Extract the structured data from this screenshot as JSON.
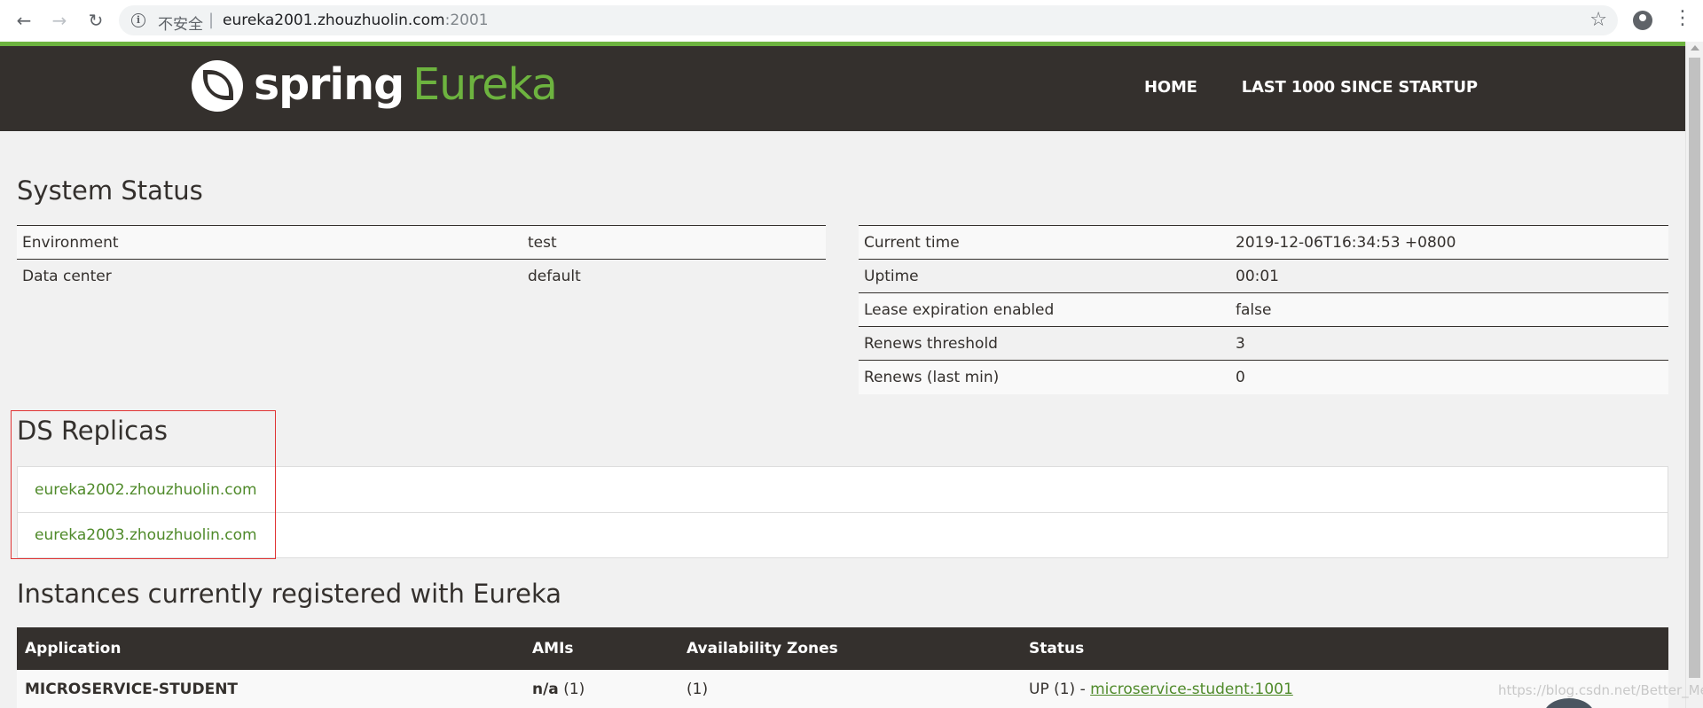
{
  "browser": {
    "back_icon": "arrow-left-icon",
    "forward_icon": "arrow-right-icon",
    "reload_icon": "reload-icon",
    "security_label": "不安全",
    "url_host": "eureka2001.zhouzhuolin.com",
    "url_port": ":2001",
    "bookmark_icon": "star-icon",
    "account_icon": "account-circle-icon",
    "menu_icon": "more-vert-icon"
  },
  "header": {
    "logo_spring": "spring",
    "logo_eureka": "Eureka",
    "nav": [
      "HOME",
      "LAST 1000 SINCE STARTUP"
    ],
    "bg_color": "#34302d",
    "accent_color": "#6db33f"
  },
  "system_status": {
    "title": "System Status",
    "left": [
      {
        "label": "Environment",
        "value": "test"
      },
      {
        "label": "Data center",
        "value": "default"
      }
    ],
    "right": [
      {
        "label": "Current time",
        "value": "2019-12-06T16:34:53 +0800"
      },
      {
        "label": "Uptime",
        "value": "00:01"
      },
      {
        "label": "Lease expiration enabled",
        "value": "false"
      },
      {
        "label": "Renews threshold",
        "value": "3"
      },
      {
        "label": "Renews (last min)",
        "value": "0"
      }
    ]
  },
  "ds_replicas": {
    "title": "DS Replicas",
    "items": [
      "eureka2002.zhouzhuolin.com",
      "eureka2003.zhouzhuolin.com"
    ]
  },
  "instances": {
    "title": "Instances currently registered with Eureka",
    "columns": [
      "Application",
      "AMIs",
      "Availability Zones",
      "Status"
    ],
    "rows": [
      {
        "application": "MICROSERVICE-STUDENT",
        "amis_main": "n/a",
        "amis_count": " (1)",
        "zones": "(1)",
        "status_prefix": "UP (1) - ",
        "status_link": "microservice-student:1001"
      }
    ]
  },
  "watermark": "https://blog.csdn.net/Better_Mei"
}
